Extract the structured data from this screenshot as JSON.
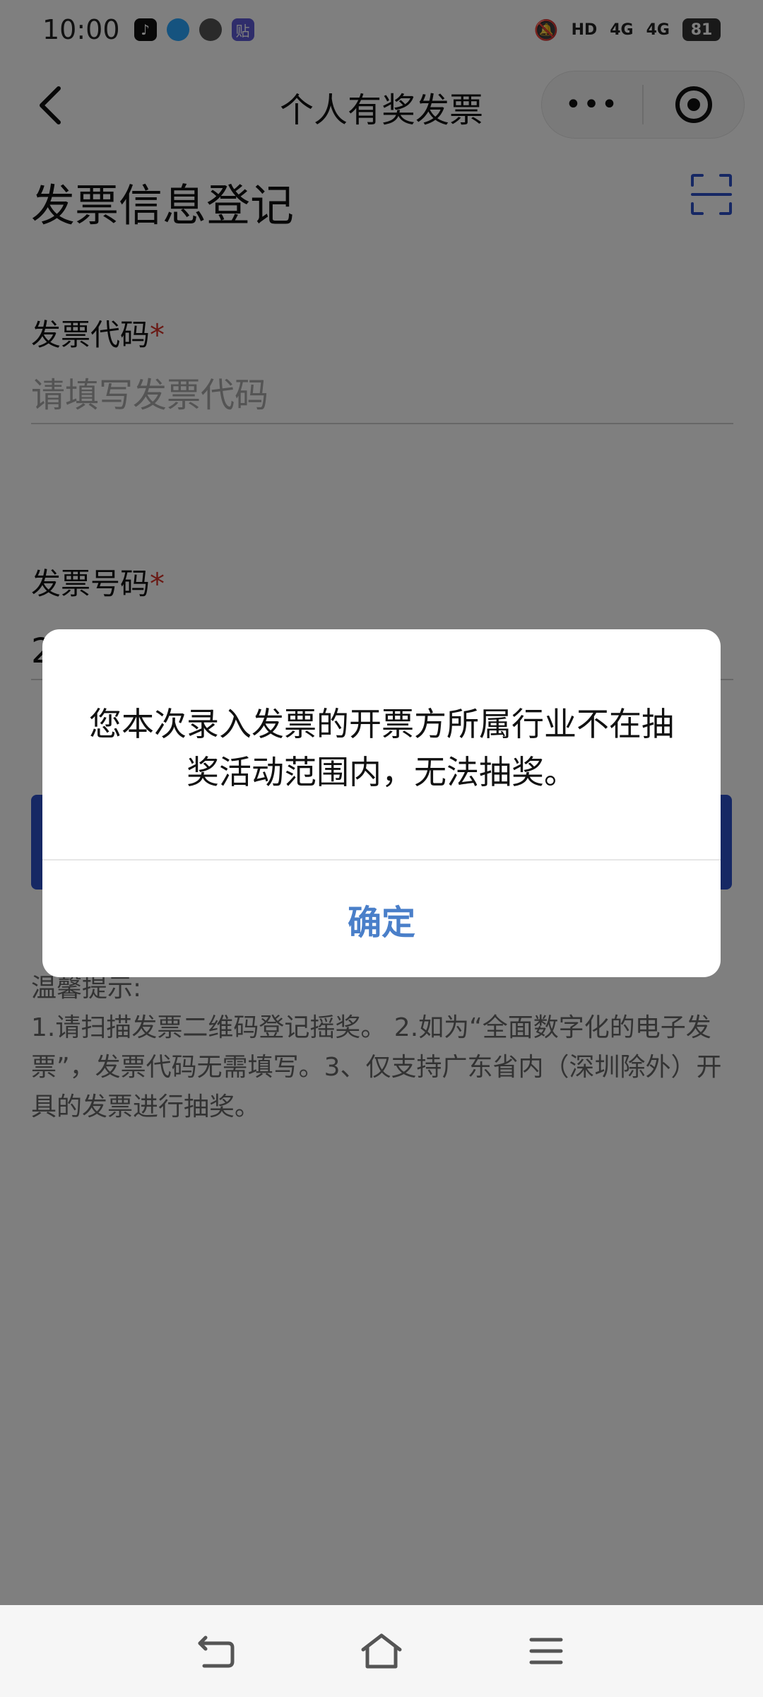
{
  "status_bar": {
    "time": "10:00",
    "apps": [
      "tiktok-icon",
      "qq-icon",
      "wechat-icon",
      "tie-icon"
    ],
    "hd": "HD",
    "signal1": "4G",
    "signal2": "4G",
    "battery": "81"
  },
  "nav": {
    "title": "个人有奖发票",
    "more": "•••"
  },
  "page": {
    "heading": "发票信息登记"
  },
  "form": {
    "code_label": "发票代码",
    "code_placeholder": "请填写发票代码",
    "code_value": "",
    "number_label": "发票号码",
    "number_value": "2",
    "required_mark": "*"
  },
  "tips": {
    "title": "温馨提示:",
    "body": "1.请扫描发票二维码登记摇奖。 2.如为“全面数字化的电子发票”，发票代码无需填写。3、仅支持广东省内（深圳除外）开具的发票进行抽奖。"
  },
  "dialog": {
    "message": "您本次录入发票的开票方所属行业不在抽奖活动范围内，无法抽奖。",
    "confirm": "确定"
  },
  "colors": {
    "accent": "#2d50c8",
    "dialog_button": "#4a7fc9",
    "required": "#d4342b"
  }
}
